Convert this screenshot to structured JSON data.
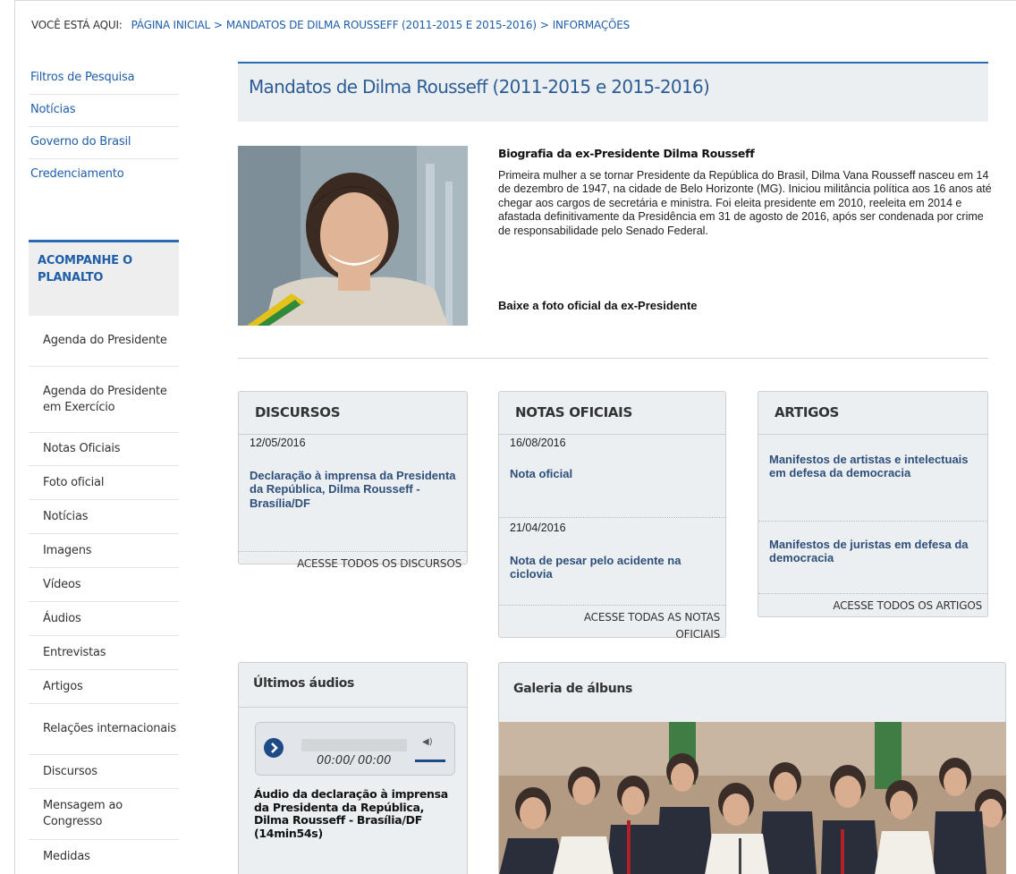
{
  "breadcrumb": {
    "label": "VOCÊ ESTÁ AQUI:",
    "items": [
      "PÁGINA INICIAL",
      "MANDATOS DE DILMA ROUSSEFF (2011-2015 E 2015-2016)",
      "INFORMAÇÕES"
    ],
    "separator": ">"
  },
  "leftnav": {
    "links": [
      "Filtros de Pesquisa",
      "Notícias",
      "Governo do Brasil",
      "Credenciamento"
    ],
    "section_title": "ACOMPANHE O PLANALTO",
    "menu": [
      "Agenda do Presidente",
      "Agenda do Presidente em Exercício",
      "Notas Oficiais",
      "Foto oficial",
      "Notícias",
      "Imagens",
      "Vídeos",
      "Áudios",
      "Entrevistas",
      "Artigos",
      "Relações internacionais",
      "Discursos",
      "Mensagem ao Congresso",
      "Medidas"
    ]
  },
  "main": {
    "title": "Mandatos de Dilma Rousseff (2011-2015 e 2015-2016)",
    "bio": {
      "heading": "Biografia da ex-Presidente Dilma Rousseff",
      "text": "Primeira mulher a se tornar Presidente da República do Brasil, Dilma Vana Rousseff nasceu em 14 de dezembro de 1947, na cidade de Belo Horizonte (MG). Iniciou militância política aos 16 anos até chegar aos cargos de secretária e ministra. Foi eleita presidente em 2010, reeleita em 2014 e afastada definitivamente da Presidência em 31 de agosto de 2016, após ser condenada por crime de responsabilidade pelo Senado Federal.",
      "download": "Baixe a foto oficial da ex-Presidente"
    },
    "discursos": {
      "header": "DISCURSOS",
      "items": [
        {
          "date": "12/05/2016",
          "title": "Declaração à imprensa da Presidenta da República, Dilma Rousseff - Brasília/DF"
        }
      ],
      "more": "ACESSE TODOS OS DISCURSOS"
    },
    "notas": {
      "header": "NOTAS OFICIAIS",
      "items": [
        {
          "date": "16/08/2016",
          "title": "Nota oficial"
        },
        {
          "date": "21/04/2016",
          "title": "Nota de pesar pelo acidente na ciclovia"
        }
      ],
      "more": "ACESSE TODAS AS NOTAS OFICIAIS"
    },
    "artigos": {
      "header": "ARTIGOS",
      "items": [
        {
          "title": "Manifestos de artistas e intelectuais em defesa da democracia"
        },
        {
          "title": "Manifestos de juristas em defesa da democracia"
        }
      ],
      "more": "ACESSE TODOS OS ARTIGOS"
    },
    "audios": {
      "header": "Últimos áudios",
      "player_time": "00:00/ 00:00",
      "title": "Áudio da declaração à imprensa da Presidenta da República, Dilma Rousseff - Brasília/DF (14min54s)"
    },
    "gallery": {
      "header": "Galeria de álbuns"
    }
  },
  "colors": {
    "link": "#1f5ea8",
    "accent": "#2b6bb6",
    "panel": "#eceff1",
    "card_title": "#2d4f7a"
  }
}
